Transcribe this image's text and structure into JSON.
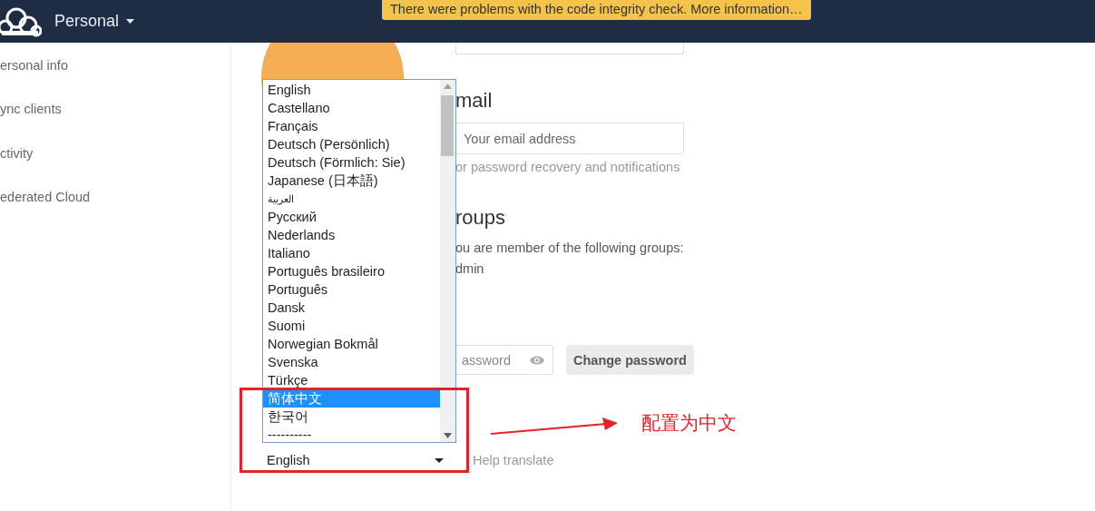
{
  "header": {
    "app_menu": "Personal"
  },
  "notification": "There were problems with the code integrity check. More information…",
  "sidebar": {
    "items": [
      {
        "label": "ersonal info"
      },
      {
        "label": "ync clients"
      },
      {
        "label": "ctivity"
      },
      {
        "label": "ederated Cloud"
      }
    ]
  },
  "profile": {
    "email_heading": "mail",
    "email_field": {
      "placeholder": "Your email address"
    },
    "email_hint": "or password recovery and notifications",
    "groups_heading": "roups",
    "groups_text": "ou are member of the following groups:",
    "groups_value": "dmin",
    "password_field": {
      "placeholder": "assword"
    },
    "change_password_button": "Change password"
  },
  "language": {
    "select_value": "English",
    "help_link": "Help translate",
    "options": [
      {
        "label": "English",
        "selected": false
      },
      {
        "label": "Castellano",
        "selected": false
      },
      {
        "label": "Français",
        "selected": false
      },
      {
        "label": "Deutsch (Persönlich)",
        "selected": false
      },
      {
        "label": "Deutsch (Förmlich: Sie)",
        "selected": false
      },
      {
        "label": "Japanese (日本語)",
        "selected": false
      },
      {
        "label": "العربية",
        "selected": false
      },
      {
        "label": "Русский",
        "selected": false
      },
      {
        "label": "Nederlands",
        "selected": false
      },
      {
        "label": "Italiano",
        "selected": false
      },
      {
        "label": "Português brasileiro",
        "selected": false
      },
      {
        "label": "Português",
        "selected": false
      },
      {
        "label": "Dansk",
        "selected": false
      },
      {
        "label": "Suomi",
        "selected": false
      },
      {
        "label": "Norwegian Bokmål",
        "selected": false
      },
      {
        "label": "Svenska",
        "selected": false
      },
      {
        "label": "Türkçe",
        "selected": false
      },
      {
        "label": "简体中文",
        "selected": true
      },
      {
        "label": "한국어",
        "selected": false
      },
      {
        "label": "----------",
        "selected": false
      }
    ]
  },
  "annotation": {
    "text": "配置为中文"
  }
}
